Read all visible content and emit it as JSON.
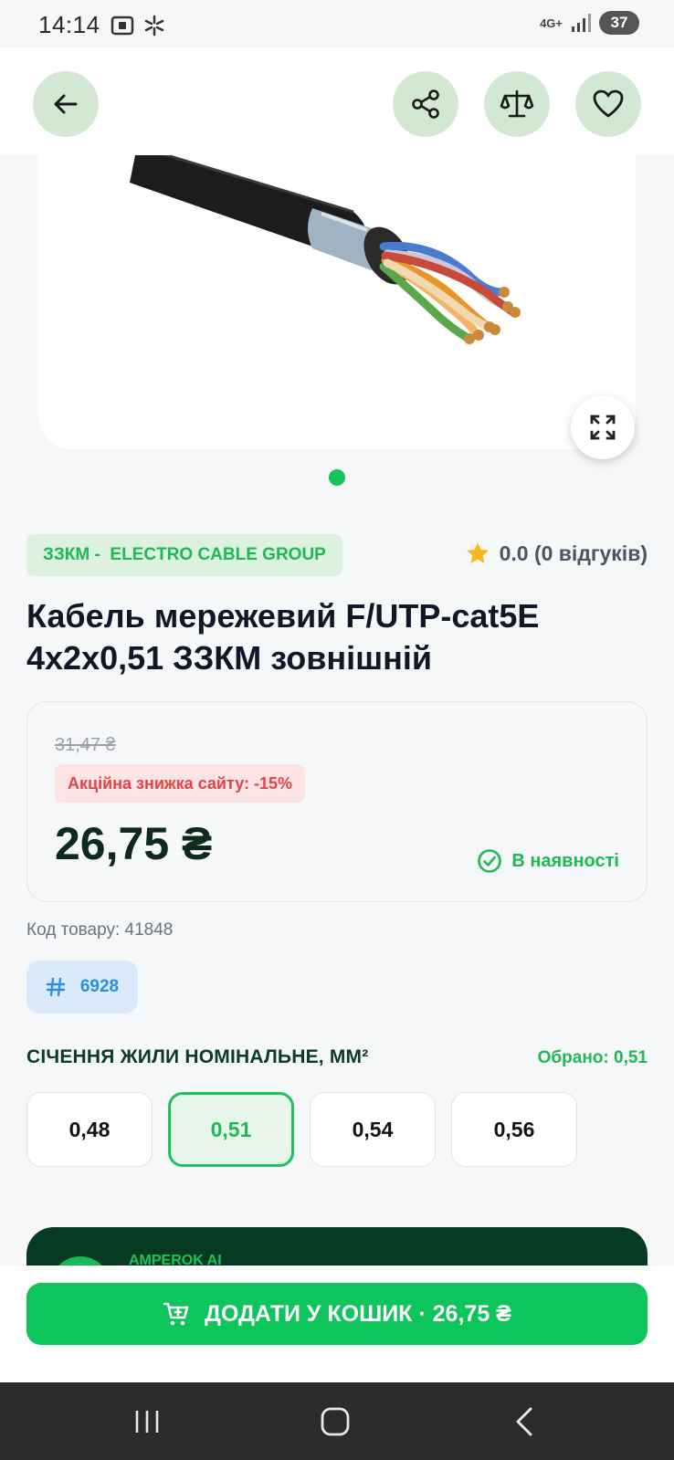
{
  "status_bar": {
    "time": "14:14",
    "network": "4G+",
    "battery": "37"
  },
  "nav": {
    "back_icon": "arrow-left-icon",
    "share_icon": "share-icon",
    "compare_icon": "scales-icon",
    "favorite_icon": "heart-icon"
  },
  "gallery": {
    "pages": 1,
    "current": 1,
    "expand_icon": "expand-icon"
  },
  "product": {
    "brand": "ЗЗКМ -  ELECTRO CABLE GROUP",
    "rating": "0.0 (0 відгуків)",
    "title": "Кабель мережевий F/UTP-cat5E 4х2х0,51 ЗЗКМ зовнішній",
    "old_price": "31,47 ₴",
    "discount": "Акційна знижка сайту: -15%",
    "price": "26,75 ₴",
    "availability": "В наявності",
    "sku": "Код товару: 41848",
    "tag": "6928"
  },
  "options": {
    "title": "СІЧЕННЯ ЖИЛИ НОМІНАЛЬНЕ, ММ²",
    "selected_label": "Обрано: 0,51",
    "values": [
      "0,48",
      "0,51",
      "0,54",
      "0,56"
    ],
    "selected_index": 1
  },
  "ai": {
    "label": "AMPEROK AI"
  },
  "cart": {
    "label": "ДОДАТИ У КОШИК · 26,75 ₴"
  },
  "colors": {
    "accent": "#0dc55a",
    "dark_green": "#073a22",
    "discount_red": "#e04545"
  }
}
